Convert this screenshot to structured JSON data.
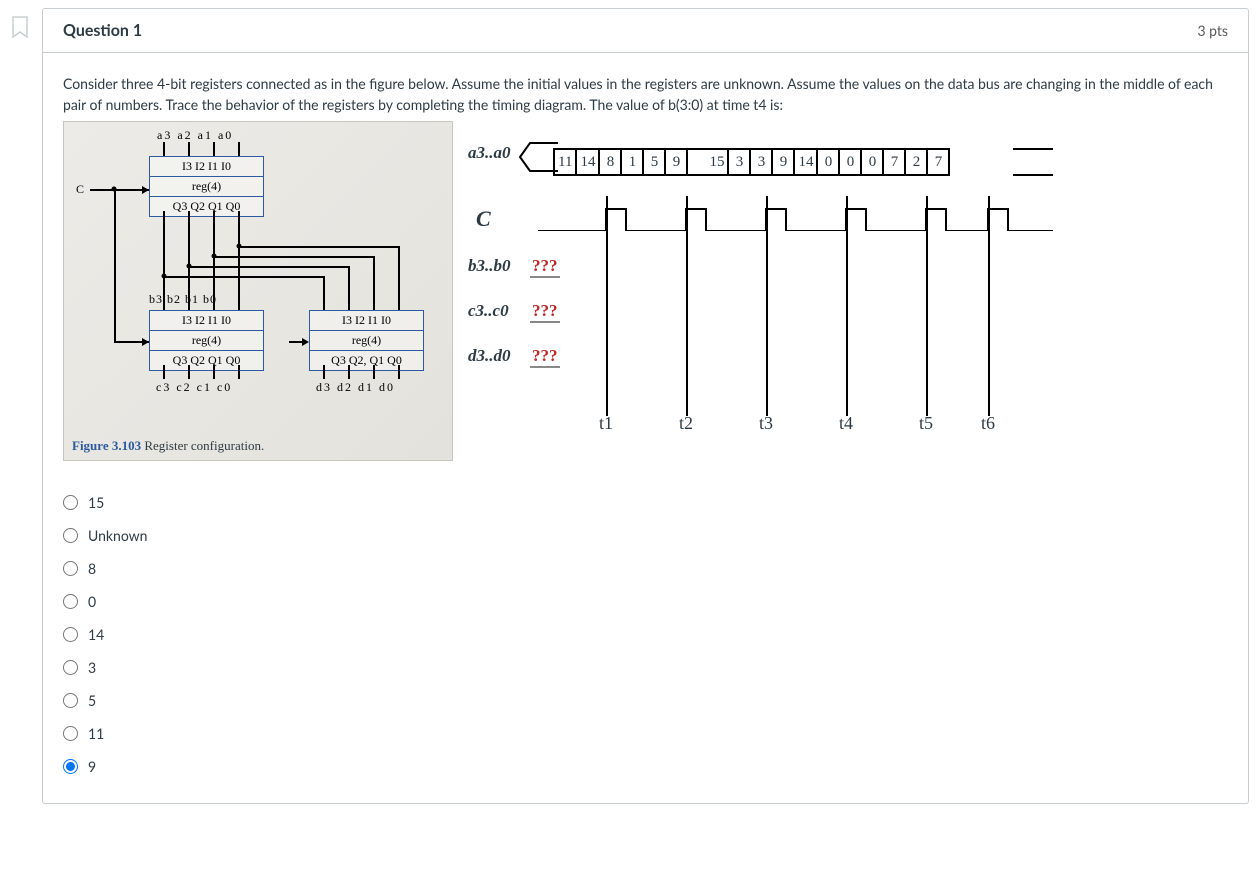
{
  "header": {
    "title": "Question 1",
    "points": "3 pts"
  },
  "prompt": "Consider three 4-bit registers connected as in the figure below.  Assume the initial values in the registers are unknown.  Assume the values on the data bus are changing in the middle of each pair of numbers.  Trace the behavior of the registers by completing the timing diagram. The value of b(3:0) at time t4 is:",
  "circuit": {
    "top_labels": "a3  a2  a1  a0",
    "reg_a_inputs": "I3   I2   I1   I0",
    "reg_a_name": "reg(4)",
    "reg_a_outputs": "Q3 Q2 Q1 Q0",
    "c_label": "C",
    "b_labels": "b3  b2  b1  b0",
    "reg_b_inputs": "I3   I2   I1   I0",
    "reg_b_name": "reg(4)",
    "reg_b_outputs": "Q3 Q2 Q1 Q0",
    "c_labels": "c3  c2  c1  c0",
    "reg_d_inputs": "I3   I2   I1   I0",
    "reg_d_name": "reg(4)",
    "reg_d_outputs": "Q3 Q2, Q1 Q0",
    "d_labels": "d3  d2  d1  d0",
    "caption_num": "Figure 3.103",
    "caption_text": " Register configuration."
  },
  "timing": {
    "a_label": "a3..a0",
    "c_label": "C",
    "b_label": "b3..b0",
    "c_sig_label": "c3..c0",
    "d_label": "d3..d0",
    "qmark": "???",
    "a_values": [
      "11",
      "14",
      "8",
      "1",
      "5",
      "9",
      "",
      "15",
      "3",
      "3",
      "9",
      "14",
      "0",
      "0",
      "0",
      "7",
      "2",
      "7"
    ],
    "t_labels": [
      "t1",
      "t2",
      "t3",
      "t4",
      "t5",
      "t6"
    ]
  },
  "options": [
    "15",
    "Unknown",
    "8",
    "0",
    "14",
    "3",
    "5",
    "11",
    "9"
  ],
  "selected_index": 8
}
